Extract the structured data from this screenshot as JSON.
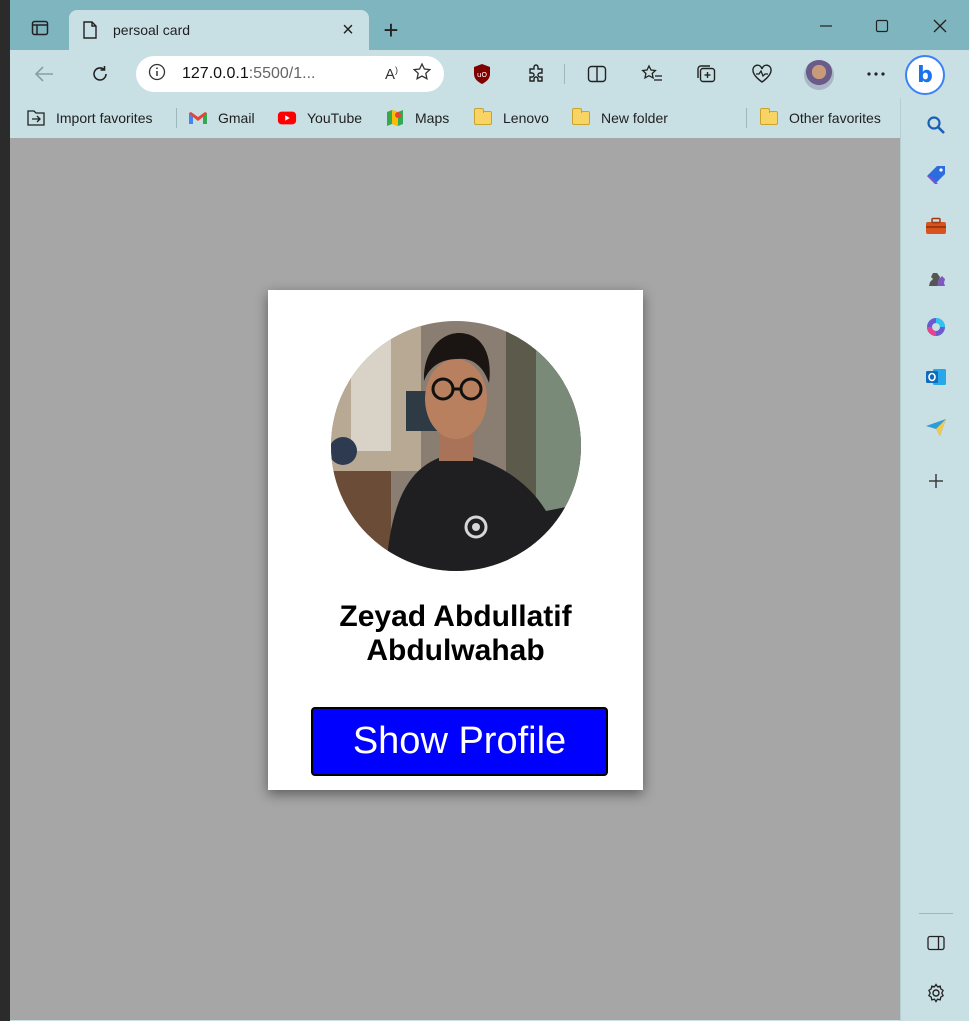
{
  "browser": {
    "tab": {
      "title": "persoal card"
    },
    "address": {
      "url_main": "127.0.0.1",
      "url_rest": ":5500/1..."
    },
    "favorites": [
      {
        "label": "Import favorites",
        "icon": "import-icon"
      },
      {
        "label": "Gmail",
        "icon": "gmail-icon"
      },
      {
        "label": "YouTube",
        "icon": "youtube-icon"
      },
      {
        "label": "Maps",
        "icon": "maps-icon"
      },
      {
        "label": "Lenovo",
        "icon": "folder-icon"
      },
      {
        "label": "New folder",
        "icon": "folder-icon"
      }
    ],
    "other_favorites": "Other favorites"
  },
  "card": {
    "name_line1": "Zeyad Abdullatif",
    "name_line2": "Abdulwahab",
    "button_label": "Show Profile"
  },
  "colors": {
    "page_bg": "#a6a6a6",
    "button_bg": "#0000ff",
    "chrome": "#c8e0e4",
    "tabstrip": "#7fb5bf"
  }
}
